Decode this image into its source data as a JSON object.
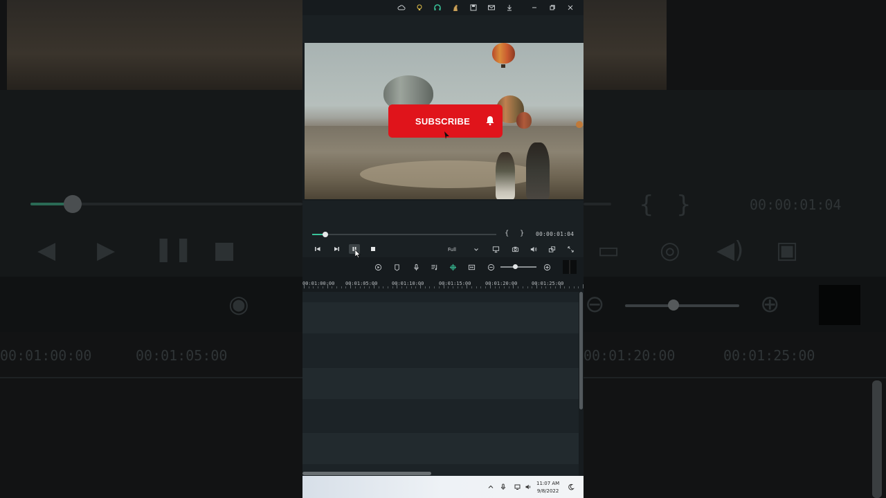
{
  "titlebar": {
    "icons": [
      "cloud-icon",
      "lightbulb-icon",
      "headset-icon",
      "horse-icon",
      "save-icon",
      "mail-icon",
      "download-icon"
    ],
    "window_controls": [
      "minimize-icon",
      "restore-icon",
      "close-icon"
    ]
  },
  "preview": {
    "subscribe_label": "SUBSCRIBE",
    "icon": "bell-icon"
  },
  "playback": {
    "progress": 0.07,
    "mark_in": "{",
    "mark_out": "}",
    "timecode": "00:00:01:04",
    "quality": "Full",
    "buttons": [
      "previous-frame-icon",
      "play-icon",
      "pause-icon",
      "stop-icon"
    ],
    "right_icons": [
      "display-icon",
      "camera-icon",
      "volume-icon",
      "fullscreen-icon",
      "expand-icon"
    ]
  },
  "timeline_toolbar": {
    "icons": [
      "render-icon",
      "marker-icon",
      "microphone-icon",
      "audio-mix-icon",
      "ai-link-icon",
      "fit-icon",
      "zoom-out-icon",
      "zoom-in-icon"
    ],
    "zoom_level": 0.4
  },
  "ruler": {
    "labels": [
      "00:01:00:00",
      "00:01:05:00",
      "00:01:10:00",
      "00:01:15:00",
      "00:01:20:00",
      "00:01:25:00"
    ]
  },
  "taskbar": {
    "time": "11:07 AM",
    "date": "9/8/2022"
  },
  "colors": {
    "accent": "#39c49a",
    "subscribe_red": "#e0141b",
    "app_bg": "#161b1e"
  }
}
